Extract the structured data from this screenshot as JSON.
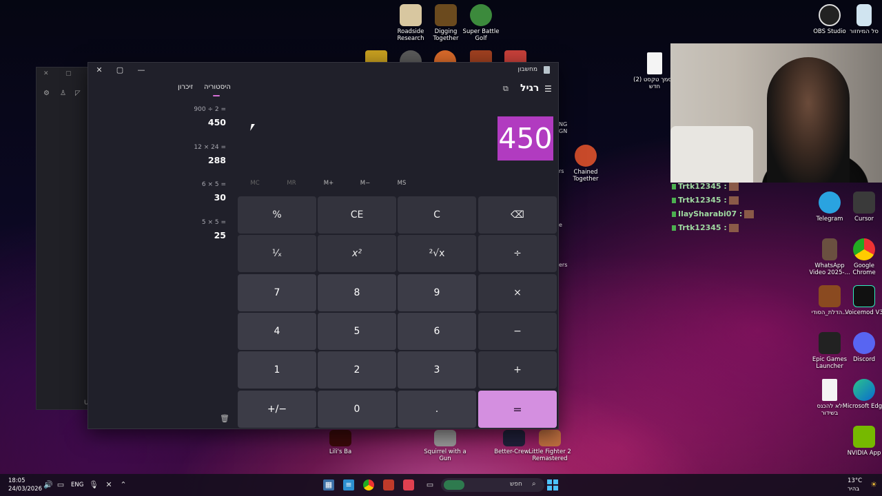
{
  "desktop": {
    "top_icons": [
      {
        "label": "Roadside Research"
      },
      {
        "label": "Digging Together"
      },
      {
        "label": "Super Battle Golf"
      }
    ],
    "right_icons": [
      {
        "label": "OBS Studio"
      },
      {
        "label": "סל המיחזור"
      },
      {
        "label": "מסמך טקסט (2) חדש"
      },
      {
        "label": "Telegram"
      },
      {
        "label": "Cursor"
      },
      {
        "label": "WhatsApp Video 2025-..."
      },
      {
        "label": "Google Chrome"
      },
      {
        "label": "הדלת_הסודי..."
      },
      {
        "label": "Voicemod V3"
      },
      {
        "label": "Epic Games Launcher"
      },
      {
        "label": "Discord"
      },
      {
        "label": "לא להכנס בשידור"
      },
      {
        "label": "Microsoft Edge"
      },
      {
        "label": "NVIDIA App"
      }
    ],
    "mid_icons": [
      {
        "label": "Chained Together"
      }
    ],
    "bottom_icons": [
      {
        "label": "Lili's Ba"
      },
      {
        "label": "Squirrel with a Gun"
      },
      {
        "label": "Better-Crew..."
      },
      {
        "label": "Little Fighter 2 Remastered"
      }
    ],
    "partial_labels": {
      "ng": "NG",
      "gn": "GN",
      "rs": "rs",
      "e": "e",
      "ers": "ers"
    }
  },
  "background_window": {
    "close_glyph": "✕",
    "maximize_glyph": "▢",
    "bottom_letter": "U"
  },
  "calculator": {
    "app_title": "מחשבון",
    "mode_title": "רגיל",
    "tabs": {
      "history": "היסטוריה",
      "memory": "זיכרון"
    },
    "display_value": "450",
    "history": [
      {
        "expression": "900  ÷  2 =",
        "result": "450"
      },
      {
        "expression": "12  ×  24 =",
        "result": "288"
      },
      {
        "expression": "6  ×  5 =",
        "result": "30"
      },
      {
        "expression": "5  ×  5 =",
        "result": "25"
      }
    ],
    "memory_buttons": [
      "MC",
      "MR",
      "M+",
      "M−",
      "MS"
    ],
    "keys": [
      [
        "%",
        "CE",
        "C",
        "⌫"
      ],
      [
        "¹⁄ₓ",
        "x²",
        "²√x",
        "÷"
      ],
      [
        "7",
        "8",
        "9",
        "×"
      ],
      [
        "4",
        "5",
        "6",
        "−"
      ],
      [
        "1",
        "2",
        "3",
        "+"
      ],
      [
        "+/−",
        "0",
        ".",
        "="
      ]
    ],
    "titlebar": {
      "close": "✕",
      "maximize": "▢",
      "minimize": "—"
    },
    "menu_glyph": "☰",
    "pin_glyph": "⧉",
    "trash_glyph": "🗑"
  },
  "chat": [
    {
      "user": "Trtk12345 :"
    },
    {
      "user": "Trtk12345 :"
    },
    {
      "user": "IlaySharabi07 :"
    },
    {
      "user": "Trtk12345 :"
    }
  ],
  "taskbar": {
    "time": "18:05",
    "date": "24/03/2026",
    "lang": "ENG",
    "search_placeholder": "חפש",
    "weather_temp": "13°C",
    "weather_desc": "בהיר"
  }
}
